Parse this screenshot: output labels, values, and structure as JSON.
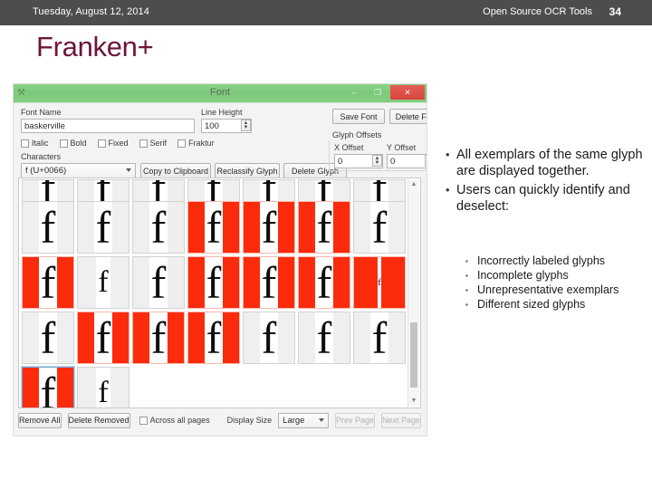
{
  "slide": {
    "header": {
      "date": "Tuesday, August 12, 2014",
      "deck_title": "Open Source OCR Tools",
      "page_number": "34",
      "background_color": "#4d4d4d",
      "text_color": "#ffffff"
    },
    "title": "Franken+",
    "title_color": "#6d1639"
  },
  "app_window": {
    "titlebar": {
      "title": "Font",
      "app_icon": "app-icon",
      "minimize_label": "–",
      "maximize_label": "❐",
      "close_label": "✕",
      "background_color": "#7cc97a",
      "close_color": "#d8453d"
    },
    "form": {
      "font_name_label": "Font Name",
      "font_name_value": "baskerville",
      "line_height_label": "Line Height",
      "line_height_value": "100",
      "style_checkboxes": [
        {
          "label": "Italic",
          "checked": false
        },
        {
          "label": "Bold",
          "checked": false
        },
        {
          "label": "Fixed",
          "checked": false
        },
        {
          "label": "Serif",
          "checked": false
        },
        {
          "label": "Fraktur",
          "checked": false
        }
      ],
      "characters_label": "Characters",
      "characters_value": "f (U+0066)",
      "copy_to_clipboard_label": "Copy to Clipboard",
      "reclassify_glyph_label": "Reclassify Glyph",
      "delete_glyph_label": "Delete Glyph",
      "save_font_label": "Save Font",
      "delete_font_label": "Delete Font",
      "glyph_offsets_label": "Glyph Offsets",
      "x_offset_label": "X Offset",
      "x_offset_value": "0",
      "y_offset_label": "Y Offset",
      "y_offset_value": "0"
    },
    "glyph_grid": {
      "glyph_char": "f",
      "selected_color": "#fb2b0c",
      "unselected_color": "#efefef",
      "rows": [
        {
          "clipped": true,
          "cells": [
            {
              "selected": false
            },
            {
              "selected": false
            },
            {
              "selected": false
            },
            {
              "selected": false
            },
            {
              "selected": false
            },
            {
              "selected": false
            },
            {
              "selected": false
            }
          ]
        },
        {
          "clipped": false,
          "cells": [
            {
              "selected": false
            },
            {
              "selected": false
            },
            {
              "selected": false
            },
            {
              "selected": true
            },
            {
              "selected": true
            },
            {
              "selected": true
            },
            {
              "selected": false
            }
          ]
        },
        {
          "clipped": false,
          "cells": [
            {
              "selected": true
            },
            {
              "selected": false,
              "size": "small"
            },
            {
              "selected": false
            },
            {
              "selected": true
            },
            {
              "selected": true
            },
            {
              "selected": true
            },
            {
              "selected": true,
              "size": "tiny"
            }
          ]
        },
        {
          "clipped": false,
          "cells": [
            {
              "selected": false
            },
            {
              "selected": true
            },
            {
              "selected": true
            },
            {
              "selected": true
            },
            {
              "selected": false
            },
            {
              "selected": false
            },
            {
              "selected": false
            }
          ]
        },
        {
          "clipped": false,
          "cells": [
            {
              "selected": true,
              "focused": true
            },
            {
              "selected": false,
              "size": "small"
            }
          ]
        }
      ],
      "scrollbar": {
        "up_arrow": "▲",
        "down_arrow": "▼"
      }
    },
    "bottom_bar": {
      "remove_all_label": "Remove All",
      "delete_removed_label": "Delete Removed",
      "across_all_pages_label": "Across all pages",
      "across_all_pages_checked": false,
      "display_size_label": "Display Size",
      "display_size_value": "Large",
      "prev_page_label": "Prev Page",
      "prev_page_disabled": true,
      "next_page_label": "Next Page",
      "next_page_disabled": true
    }
  },
  "content": {
    "bullets": [
      "All exemplars of the same glyph are displayed together.",
      "Users can quickly identify and deselect:"
    ],
    "sub_bullets": [
      "Incorrectly labeled glyphs",
      "Incomplete glyphs",
      "Unrepresentative exemplars",
      "Different sized glyphs"
    ]
  }
}
